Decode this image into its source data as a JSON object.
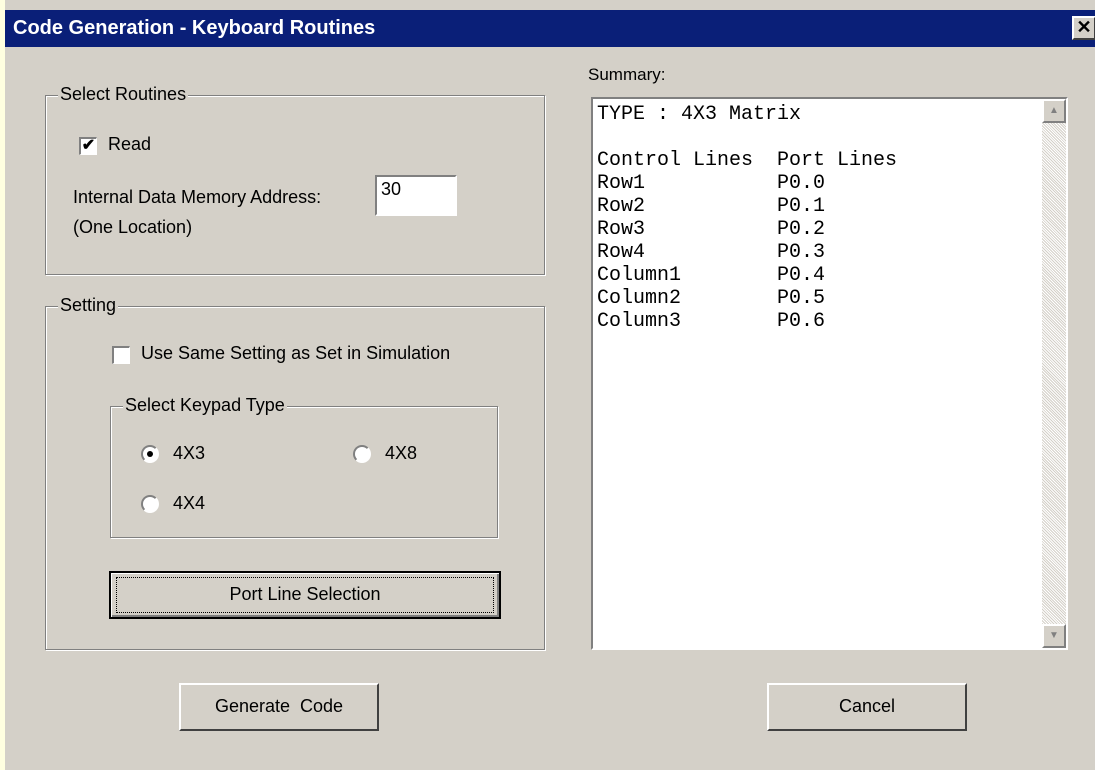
{
  "window": {
    "title": "Code Generation - Keyboard Routines",
    "close_glyph": "✕"
  },
  "select_routines": {
    "legend": "Select Routines",
    "read_label": "Read",
    "read_checked": true,
    "address_label": "Internal Data Memory Address:",
    "address_value": "30",
    "location_note": "(One Location)"
  },
  "setting": {
    "legend": "Setting",
    "use_same_label": "Use Same Setting as Set in Simulation",
    "use_same_checked": false,
    "keypad": {
      "legend": "Select Keypad Type",
      "options": [
        {
          "label": "4X3",
          "selected": true
        },
        {
          "label": "4X8",
          "selected": false
        },
        {
          "label": "4X4",
          "selected": false
        }
      ]
    },
    "port_line_button": "Port Line Selection"
  },
  "summary": {
    "label": "Summary:",
    "text": "TYPE : 4X3 Matrix\n\nControl Lines  Port Lines\nRow1           P0.0\nRow2           P0.1\nRow3           P0.2\nRow4           P0.3\nColumn1        P0.4\nColumn2        P0.5\nColumn3        P0.6"
  },
  "footer": {
    "generate_label": "Generate  Code",
    "cancel_label": "Cancel"
  },
  "icons": {
    "check": "✔",
    "arrow_up": "▲",
    "arrow_down": "▼"
  },
  "colors": {
    "titlebar": "#0a1f78",
    "dialog": "#d4d0c8"
  }
}
